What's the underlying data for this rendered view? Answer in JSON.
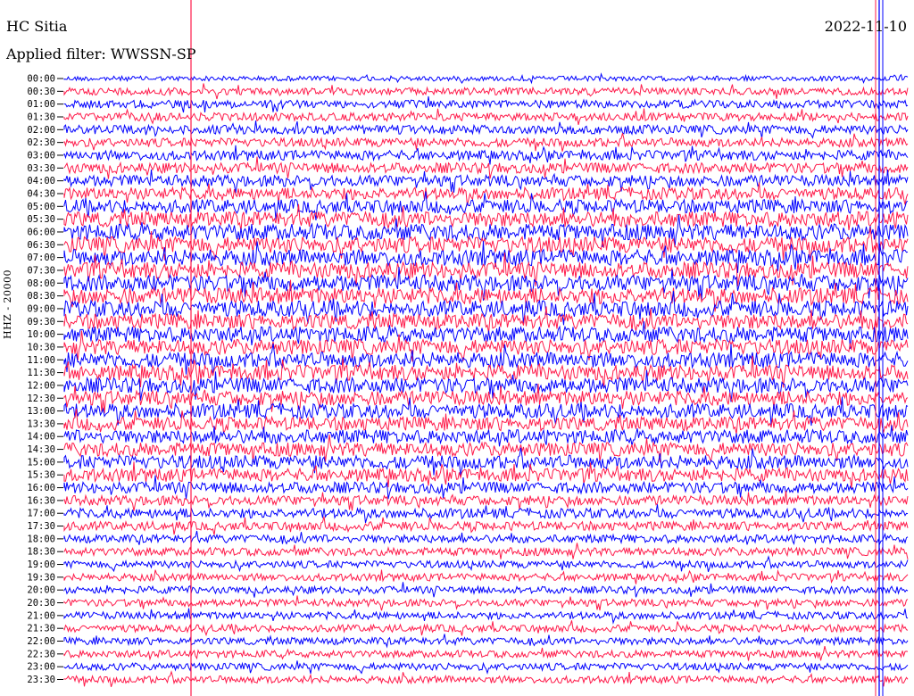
{
  "header": {
    "station": "HC Sitia",
    "filter_label": "Applied filter: WWSSN-SP",
    "date": "2022-11-10",
    "channel": "HHZ - 20000"
  },
  "chart_data": {
    "type": "line",
    "title": "HC Sitia",
    "subtitle": "Applied filter: WWSSN-SP",
    "ylabel": "HHZ - 20000",
    "tick_labels": [
      "00:00",
      "00:30",
      "01:00",
      "01:30",
      "02:00",
      "02:30",
      "03:00",
      "03:30",
      "04:00",
      "04:30",
      "05:00",
      "05:30",
      "06:00",
      "06:30",
      "07:00",
      "07:30",
      "08:00",
      "08:30",
      "09:00",
      "09:30",
      "10:00",
      "10:30",
      "11:00",
      "11:30",
      "12:00",
      "12:30",
      "13:00",
      "13:30",
      "14:00",
      "14:30",
      "15:00",
      "15:30",
      "16:00",
      "16:30",
      "17:00",
      "17:30",
      "18:00",
      "18:30",
      "19:00",
      "19:30",
      "20:00",
      "20:30",
      "21:00",
      "21:30",
      "22:00",
      "22:30",
      "23:00",
      "23:30"
    ],
    "series_colors": [
      "#0000ff",
      "#ff1a4a"
    ],
    "amplitude_profile": [
      0.3,
      0.45,
      0.5,
      0.5,
      0.55,
      0.55,
      0.6,
      0.65,
      0.7,
      0.75,
      0.85,
      0.95,
      1.0,
      1.0,
      1.0,
      1.0,
      1.0,
      1.0,
      1.0,
      0.95,
      0.95,
      0.95,
      0.95,
      0.95,
      0.95,
      0.9,
      0.9,
      0.85,
      0.85,
      0.85,
      0.85,
      0.8,
      0.7,
      0.6,
      0.6,
      0.55,
      0.5,
      0.5,
      0.45,
      0.45,
      0.45,
      0.45,
      0.45,
      0.45,
      0.45,
      0.45,
      0.45,
      0.45
    ],
    "grid": false
  }
}
